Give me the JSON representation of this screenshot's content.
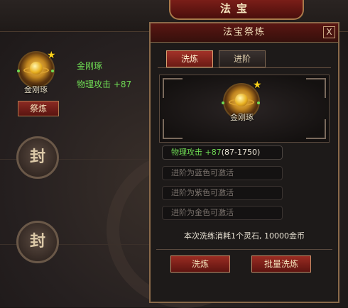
{
  "window": {
    "title": "法宝"
  },
  "left": {
    "item_name": "金刚琢",
    "item_stat": "物理攻击 +87",
    "icon_label": "金刚琢",
    "refine_button": "祭炼",
    "sealed_slots": [
      "封",
      "封"
    ]
  },
  "popup": {
    "title": "法宝祭炼",
    "close_label": "X",
    "tabs": [
      {
        "label": "洗炼",
        "active": true
      },
      {
        "label": "进阶",
        "active": false
      }
    ],
    "preview_label": "金刚琢",
    "attributes": [
      {
        "text": "物理攻击 +87",
        "range": "(87-1750)",
        "active": true
      },
      {
        "text": "进阶为蓝色可激活",
        "active": false
      },
      {
        "text": "进阶为紫色可激活",
        "active": false
      },
      {
        "text": "进阶为金色可激活",
        "active": false
      }
    ],
    "cost_text": "本次洗练消耗1个灵石, 10000金币",
    "buttons": {
      "refine": "洗炼",
      "batch_refine": "批量洗炼"
    }
  },
  "colors": {
    "green": "#6fdc54",
    "accent_red": "#8a2a22",
    "gold": "#ffd31a"
  }
}
